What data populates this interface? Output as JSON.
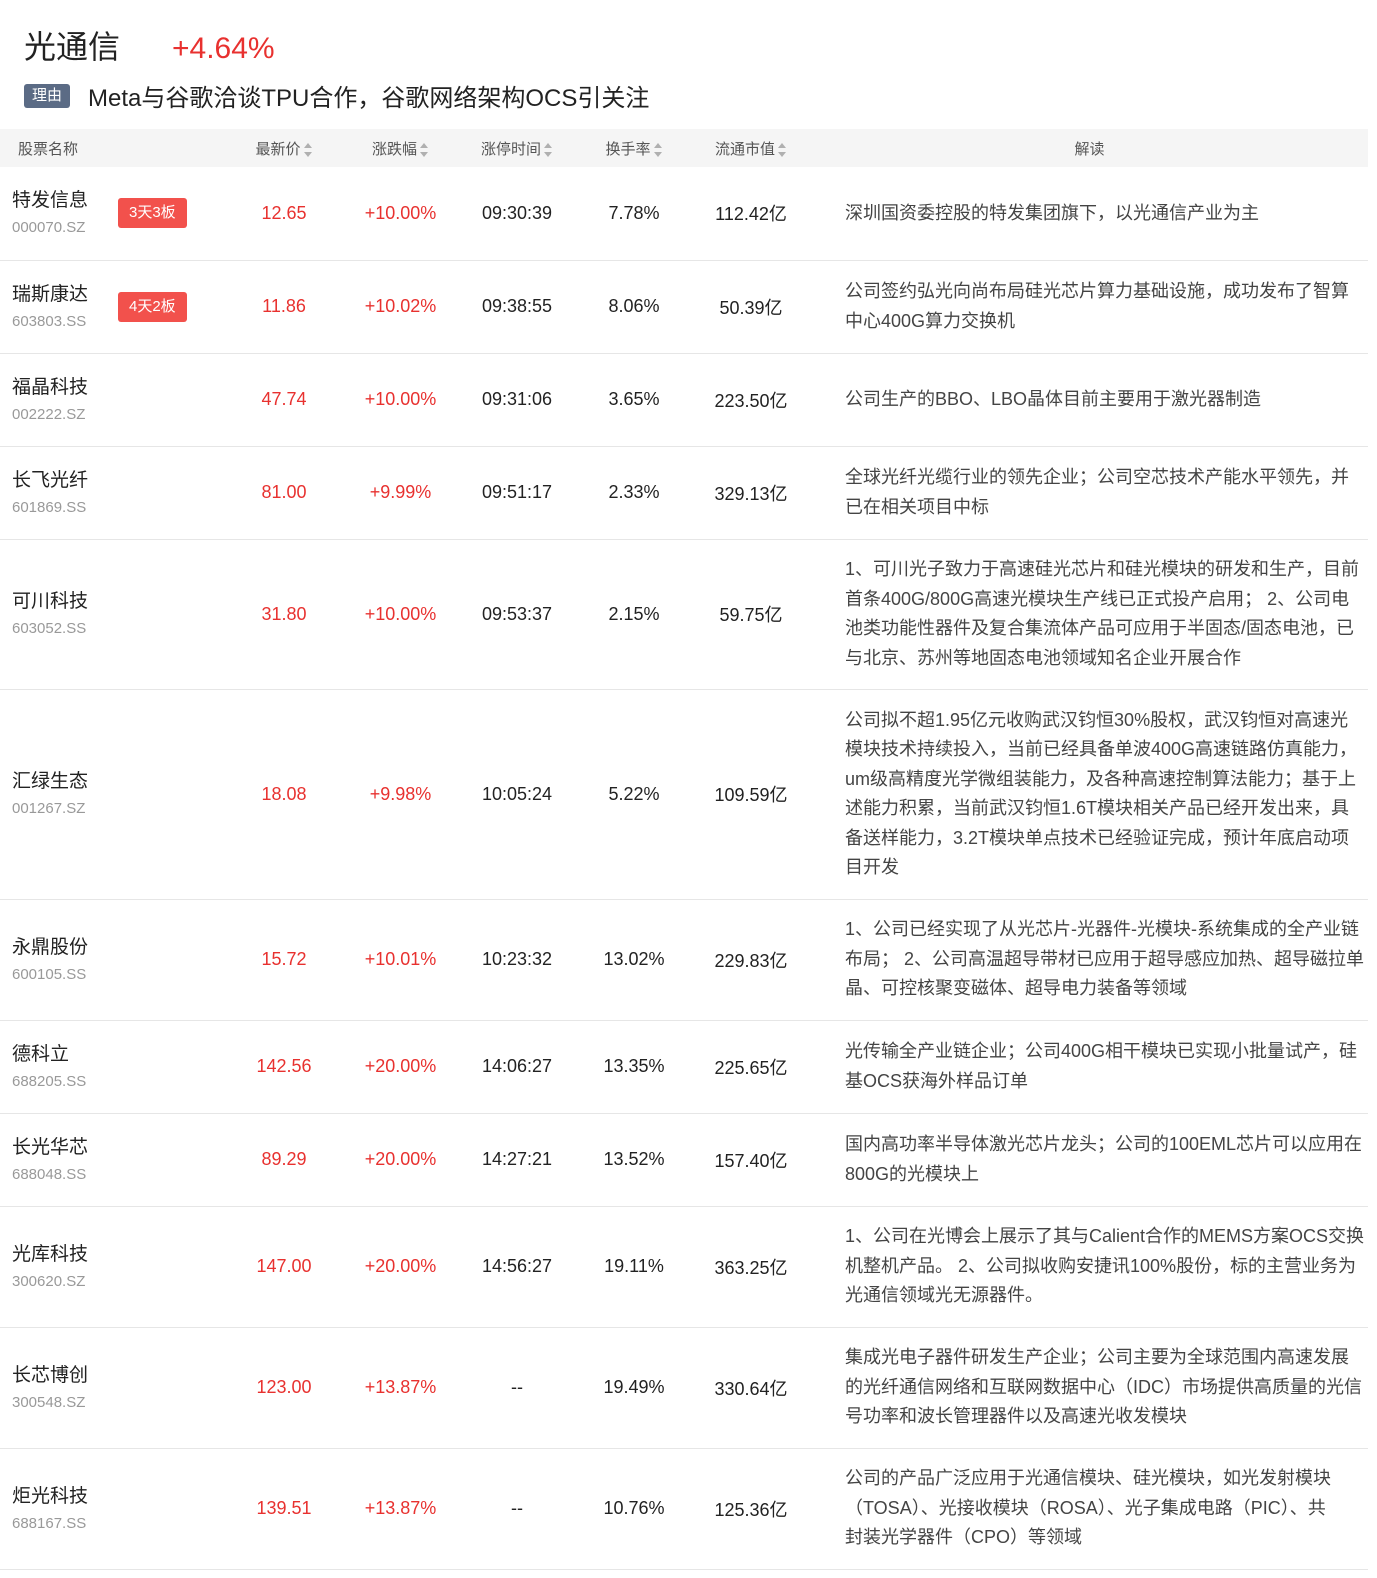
{
  "header": {
    "sector_name": "光通信",
    "sector_change": "+4.64%",
    "reason_tag": "理由",
    "reason_text": "Meta与谷歌洽谈TPU合作，谷歌网络架构OCS引关注"
  },
  "table": {
    "columns": {
      "name": "股票名称",
      "price": "最新价",
      "change": "涨跌幅",
      "limit_time": "涨停时间",
      "turnover": "换手率",
      "float_cap": "流通市值",
      "desc": "解读"
    },
    "rows": [
      {
        "name": "特发信息",
        "code": "000070.SZ",
        "badge": "3天3板",
        "price": "12.65",
        "change": "+10.00%",
        "limit_time": "09:30:39",
        "turnover": "7.78%",
        "float_cap": "112.42亿",
        "desc": [
          "深圳国资委控股的特发集团旗下，以光通信产业为主"
        ]
      },
      {
        "name": "瑞斯康达",
        "code": "603803.SS",
        "badge": "4天2板",
        "price": "11.86",
        "change": "+10.02%",
        "limit_time": "09:38:55",
        "turnover": "8.06%",
        "float_cap": "50.39亿",
        "desc": [
          "公司签约弘光向尚布局硅光芯片算力基础设施，成功发布了智算",
          "中心400G算力交换机"
        ]
      },
      {
        "name": "福晶科技",
        "code": "002222.SZ",
        "badge": "",
        "price": "47.74",
        "change": "+10.00%",
        "limit_time": "09:31:06",
        "turnover": "3.65%",
        "float_cap": "223.50亿",
        "desc": [
          "公司生产的BBO、LBO晶体目前主要用于激光器制造"
        ]
      },
      {
        "name": "长飞光纤",
        "code": "601869.SS",
        "badge": "",
        "price": "81.00",
        "change": "+9.99%",
        "limit_time": "09:51:17",
        "turnover": "2.33%",
        "float_cap": "329.13亿",
        "desc": [
          "全球光纤光缆行业的领先企业；公司空芯技术产能水平领先，并",
          "已在相关项目中标"
        ]
      },
      {
        "name": "可川科技",
        "code": "603052.SS",
        "badge": "",
        "price": "31.80",
        "change": "+10.00%",
        "limit_time": "09:53:37",
        "turnover": "2.15%",
        "float_cap": "59.75亿",
        "desc": [
          "1、可川光子致力于高速硅光芯片和硅光模块的研发和生产，目前",
          "首条400G/800G高速光模块生产线已正式投产启用； 2、公司电",
          "池类功能性器件及复合集流体产品可应用于半固态/固态电池，已",
          "与北京、苏州等地固态电池领域知名企业开展合作"
        ]
      },
      {
        "name": "汇绿生态",
        "code": "001267.SZ",
        "badge": "",
        "price": "18.08",
        "change": "+9.98%",
        "limit_time": "10:05:24",
        "turnover": "5.22%",
        "float_cap": "109.59亿",
        "desc": [
          "公司拟不超1.95亿元收购武汉钧恒30%股权，武汉钧恒对高速光",
          "模块技术持续投入，当前已经具备单波400G高速链路仿真能力，",
          "um级高精度光学微组装能力，及各种高速控制算法能力；基于上",
          "述能力积累，当前武汉钧恒1.6T模块相关产品已经开发出来，具",
          "备送样能力，3.2T模块单点技术已经验证完成，预计年底启动项",
          "目开发"
        ]
      },
      {
        "name": "永鼎股份",
        "code": "600105.SS",
        "badge": "",
        "price": "15.72",
        "change": "+10.01%",
        "limit_time": "10:23:32",
        "turnover": "13.02%",
        "float_cap": "229.83亿",
        "desc": [
          "1、公司已经实现了从光芯片-光器件-光模块-系统集成的全产业链",
          "布局； 2、公司高温超导带材已应用于超导感应加热、超导磁拉单",
          "晶、可控核聚变磁体、超导电力装备等领域"
        ]
      },
      {
        "name": "德科立",
        "code": "688205.SS",
        "badge": "",
        "price": "142.56",
        "change": "+20.00%",
        "limit_time": "14:06:27",
        "turnover": "13.35%",
        "float_cap": "225.65亿",
        "desc": [
          "光传输全产业链企业；公司400G相干模块已实现小批量试产，硅",
          "基OCS获海外样品订单"
        ]
      },
      {
        "name": "长光华芯",
        "code": "688048.SS",
        "badge": "",
        "price": "89.29",
        "change": "+20.00%",
        "limit_time": "14:27:21",
        "turnover": "13.52%",
        "float_cap": "157.40亿",
        "desc": [
          "国内高功率半导体激光芯片龙头；公司的100EML芯片可以应用在",
          "800G的光模块上"
        ]
      },
      {
        "name": "光库科技",
        "code": "300620.SZ",
        "badge": "",
        "price": "147.00",
        "change": "+20.00%",
        "limit_time": "14:56:27",
        "turnover": "19.11%",
        "float_cap": "363.25亿",
        "desc": [
          "1、公司在光博会上展示了其与Calient合作的MEMS方案OCS交换",
          "机整机产品。 2、公司拟收购安捷讯100%股份，标的主营业务为",
          "光通信领域光无源器件。"
        ]
      },
      {
        "name": "长芯博创",
        "code": "300548.SZ",
        "badge": "",
        "price": "123.00",
        "change": "+13.87%",
        "limit_time": "--",
        "turnover": "19.49%",
        "float_cap": "330.64亿",
        "desc": [
          "集成光电子器件研发生产企业；公司主要为全球范围内高速发展",
          "的光纤通信网络和互联网数据中心（IDC）市场提供高质量的光信",
          "号功率和波长管理器件以及高速光收发模块"
        ]
      },
      {
        "name": "炬光科技",
        "code": "688167.SS",
        "badge": "",
        "price": "139.51",
        "change": "+13.87%",
        "limit_time": "--",
        "turnover": "10.76%",
        "float_cap": "125.36亿",
        "desc": [
          "公司的产品广泛应用于光通信模块、硅光模块，如光发射模块",
          "（TOSA）、光接收模块（ROSA）、光子集成电路（PIC）、共",
          "封装光学器件（CPO）等领域"
        ]
      }
    ]
  },
  "colors": {
    "up_red": "#e8312f",
    "badge_red": "#f2514c",
    "reason_tag_bg": "#5b6b85",
    "header_bg": "#f5f5f5"
  },
  "icons": {
    "sort": "sort-updown-icon"
  }
}
